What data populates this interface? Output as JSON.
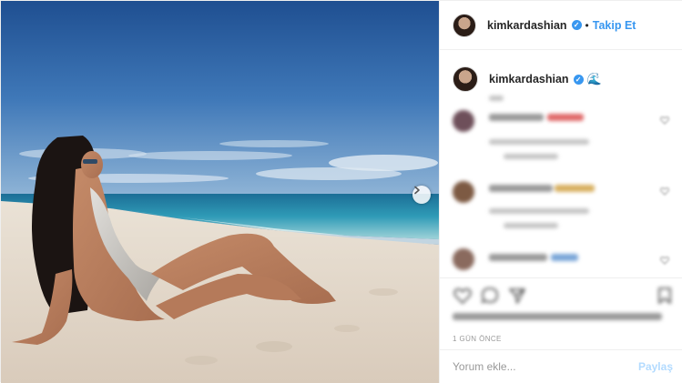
{
  "header": {
    "username": "kimkardashian",
    "separator": "•",
    "follow_label": "Takip Et",
    "verified_icon": "verified-badge-icon"
  },
  "caption": {
    "username": "kimkardashian",
    "emoji": "🌊"
  },
  "footer": {
    "timestamp": "1 GÜN ÖNCE"
  },
  "comment_input": {
    "placeholder": "Yorum ekle...",
    "post_label": "Paylaş"
  },
  "colors": {
    "accent": "#3897f0",
    "post_disabled": "#b3dbff",
    "text": "#262626",
    "muted": "#999999"
  }
}
